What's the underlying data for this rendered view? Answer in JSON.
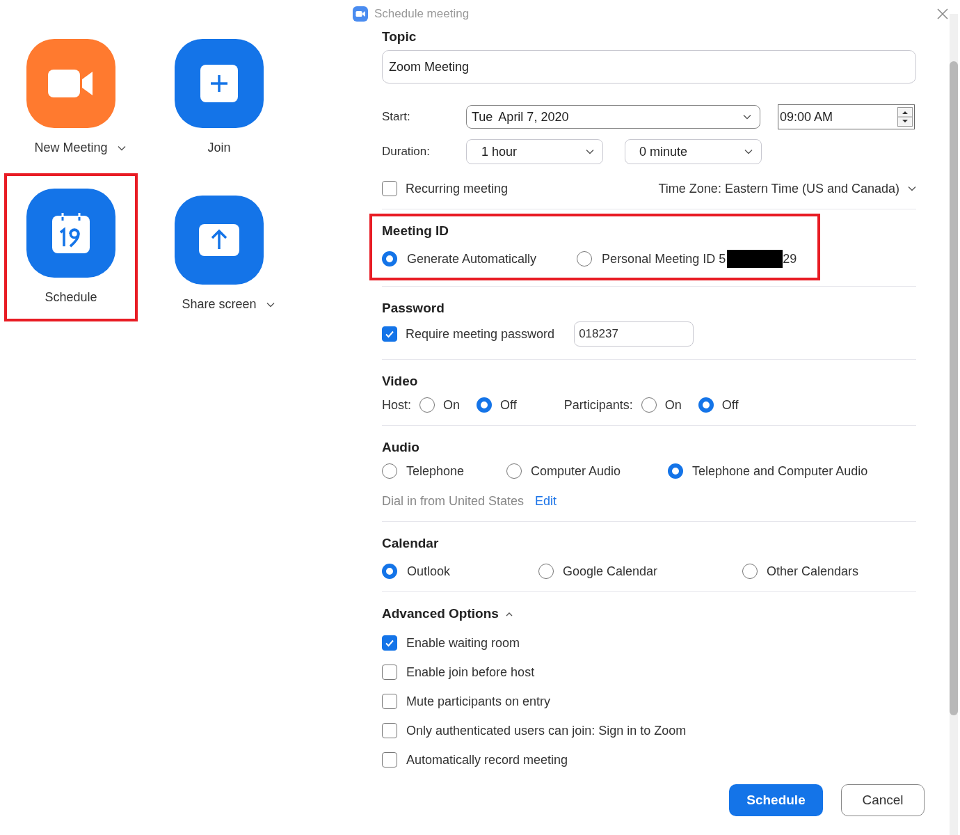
{
  "launcher": {
    "tiles": [
      {
        "kind": "new_meeting",
        "label": "New Meeting",
        "dropdown": true,
        "highlighted": false
      },
      {
        "kind": "join",
        "label": "Join",
        "dropdown": false,
        "highlighted": false
      },
      {
        "kind": "schedule",
        "label": "Schedule",
        "dropdown": false,
        "highlighted": true
      },
      {
        "kind": "share",
        "label": "Share screen",
        "dropdown": true,
        "highlighted": false
      }
    ]
  },
  "dialog": {
    "title": "Schedule meeting",
    "topic": {
      "label": "Topic",
      "value": "Zoom Meeting"
    },
    "start": {
      "label": "Start:",
      "day": "Tue",
      "date": "April 7, 2020",
      "time": "09:00 AM"
    },
    "duration": {
      "label": "Duration:",
      "hours": "1 hour",
      "minutes": "0 minute"
    },
    "recurring": {
      "label": "Recurring meeting",
      "checked": false
    },
    "time_zone": "Time Zone: Eastern Time (US and Canada)",
    "meeting_id": {
      "title": "Meeting ID",
      "highlighted": true,
      "options": [
        {
          "label": "Generate Automatically",
          "selected": true
        },
        {
          "label": "Personal Meeting ID 5",
          "redacted": true,
          "suffix": "29",
          "selected": false
        }
      ]
    },
    "password": {
      "title": "Password",
      "require": {
        "label": "Require meeting password",
        "checked": true
      },
      "value": "018237"
    },
    "video": {
      "title": "Video",
      "groups": [
        {
          "label": "Host:",
          "options": [
            {
              "label": "On",
              "selected": false
            },
            {
              "label": "Off",
              "selected": true
            }
          ]
        },
        {
          "label": "Participants:",
          "options": [
            {
              "label": "On",
              "selected": false
            },
            {
              "label": "Off",
              "selected": true
            }
          ]
        }
      ]
    },
    "audio": {
      "title": "Audio",
      "options": [
        {
          "label": "Telephone",
          "selected": false
        },
        {
          "label": "Computer Audio",
          "selected": false
        },
        {
          "label": "Telephone and Computer Audio",
          "selected": true
        }
      ],
      "dial_in": "Dial in from United States",
      "edit_link": "Edit"
    },
    "calendar": {
      "title": "Calendar",
      "options": [
        {
          "label": "Outlook",
          "selected": true
        },
        {
          "label": "Google Calendar",
          "selected": false
        },
        {
          "label": "Other Calendars",
          "selected": false
        }
      ]
    },
    "advanced": {
      "title": "Advanced Options",
      "expanded": true,
      "options": [
        {
          "label": "Enable waiting room",
          "checked": true
        },
        {
          "label": "Enable join before host",
          "checked": false
        },
        {
          "label": "Mute participants on entry",
          "checked": false
        },
        {
          "label": "Only authenticated users can join: Sign in to Zoom",
          "checked": false
        },
        {
          "label": "Automatically record meeting",
          "checked": false
        }
      ]
    },
    "buttons": [
      {
        "kind": "primary",
        "label": "Schedule"
      },
      {
        "kind": "secondary",
        "label": "Cancel"
      }
    ]
  }
}
